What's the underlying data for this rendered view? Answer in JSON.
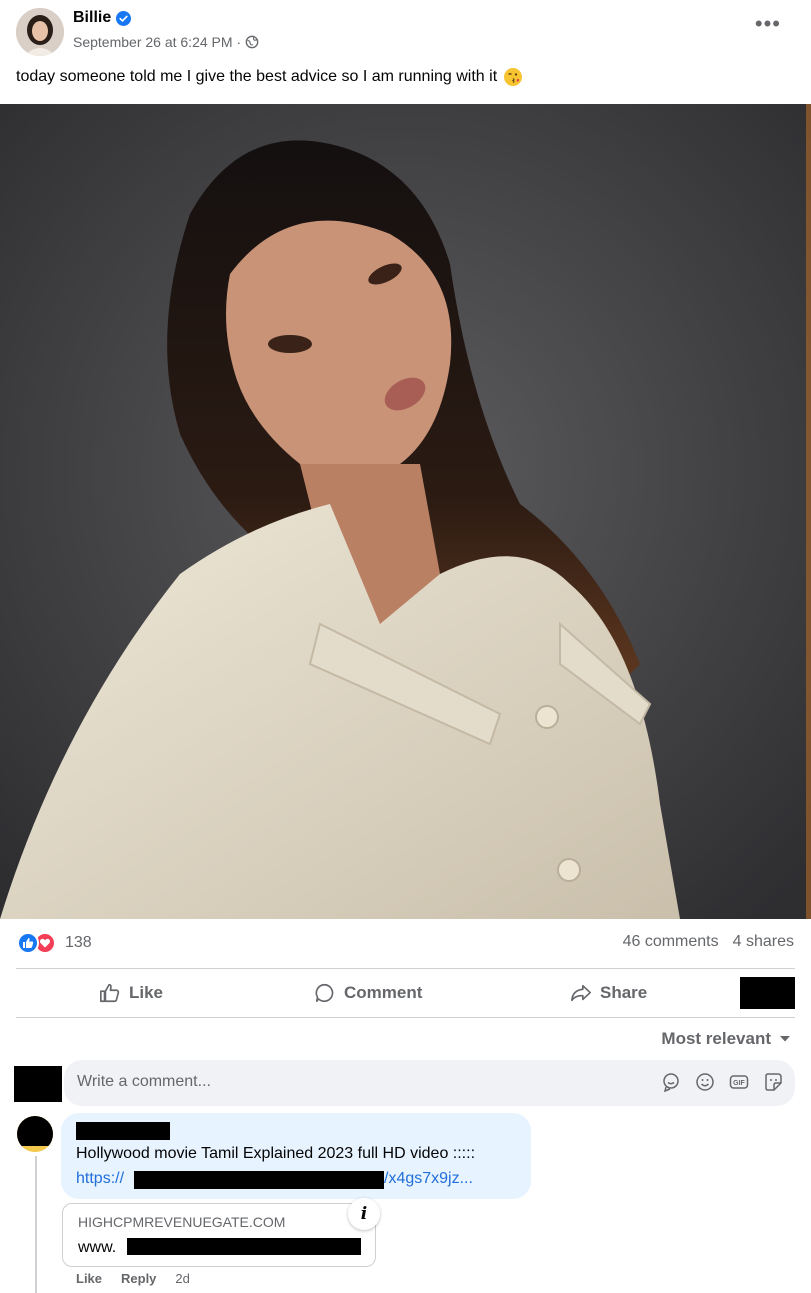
{
  "post": {
    "author": "Billie",
    "timestamp": "September 26 at 6:24 PM",
    "meta_separator": "·",
    "more_label": "•••",
    "text": "today someone told me I give the best advice so I am running with it"
  },
  "stats": {
    "reactions_count": "138",
    "comments": "46 comments",
    "shares": "4 shares"
  },
  "actions": {
    "like": "Like",
    "comment": "Comment",
    "share": "Share"
  },
  "comments_section": {
    "sort_label": "Most relevant",
    "write_placeholder": "Write a comment..."
  },
  "comment": {
    "text": "Hollywood movie Tamil Explained 2023 full HD video :::::",
    "link_start": "https://",
    "link_end": "/x4gs7x9jz...",
    "preview_domain": "HIGHCPMREVENUEGATE.COM",
    "preview_url_start": "www.",
    "info_label": "i",
    "like": "Like",
    "reply": "Reply",
    "age": "2d"
  },
  "colors": {
    "brand_blue": "#1877f2",
    "love_red": "#f33e58",
    "secondary_text": "#65676b",
    "link": "#216fdb",
    "bubble": "#e7f3ff"
  }
}
